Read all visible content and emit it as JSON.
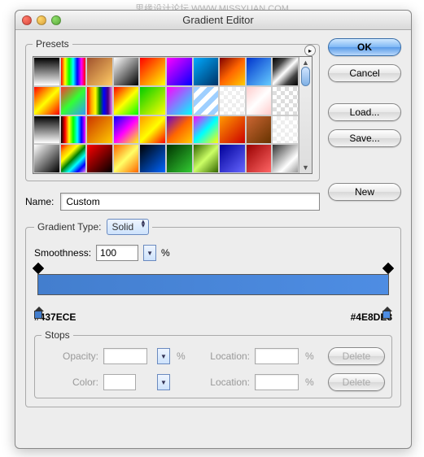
{
  "watermark": "思缘设计论坛  WWW.MISSYUAN.COM",
  "window": {
    "title": "Gradient Editor"
  },
  "buttons": {
    "ok": "OK",
    "cancel": "Cancel",
    "load": "Load...",
    "save": "Save...",
    "new": "New",
    "delete": "Delete"
  },
  "presets": {
    "legend": "Presets"
  },
  "name": {
    "label": "Name:",
    "value": "Custom"
  },
  "gradientType": {
    "label": "Gradient Type:",
    "value": "Solid"
  },
  "smoothness": {
    "label": "Smoothness:",
    "value": "100",
    "unit": "%"
  },
  "gradient": {
    "leftHex": "#437ECE",
    "rightHex": "#4E8DE3"
  },
  "stops": {
    "legend": "Stops",
    "opacityLabel": "Opacity:",
    "colorLabel": "Color:",
    "locationLabel": "Location:",
    "opacityValue": "",
    "opacityLocation": "",
    "colorLocation": "",
    "unit": "%"
  },
  "swatchGradients": [
    "linear-gradient(#000,#fff)",
    "linear-gradient(90deg,red,yellow,lime,cyan,blue,magenta,red)",
    "linear-gradient(135deg,#a0522d,#ffcc66)",
    "linear-gradient(135deg,#fff,#000)",
    "linear-gradient(135deg,#f00,#ff0)",
    "linear-gradient(135deg,#ff00ff,#00f)",
    "linear-gradient(135deg,#00aaff,#003366)",
    "linear-gradient(135deg,#800000,#ff6600,#ffcc00)",
    "linear-gradient(135deg,#0033cc,#66ccff)",
    "linear-gradient(135deg,#000,#444,#fff,#444,#000)",
    "linear-gradient(135deg,#ff0000,#ffff00,#ff0000)",
    "linear-gradient(135deg,#ff3333,#33ff33,#3399ff)",
    "linear-gradient(90deg,red,orange,yellow,green,blue,indigo,violet)",
    "linear-gradient(135deg,red,yellow,lime)",
    "linear-gradient(135deg,#00cc00,#ffff00)",
    "linear-gradient(135deg,#ff00ff,#00ffff)",
    "repeating-linear-gradient(135deg,#9ecfff 0 6px,#fff 6px 12px)",
    "repeating-conic-gradient(#eee 0 25%,#fff 0 50%)",
    "linear-gradient(135deg,#ffcccc,#fff,#ffcccc)",
    "repeating-conic-gradient(#ddd 0 25%,#fff 0 50%)",
    "linear-gradient(#000,#fff)",
    "linear-gradient(90deg,#000,red,yellow,lime,cyan,blue,magenta)",
    "linear-gradient(135deg,#cc3300,#ffcc00)",
    "linear-gradient(135deg,#0000ff,#ff00ff,#ffff00)",
    "linear-gradient(135deg,#ff9900,#ffff00,#ff0000)",
    "linear-gradient(135deg,#6600cc,#ff6600,#ffcc00)",
    "linear-gradient(135deg,#ff00ff,#00ffff,#ffff00)",
    "linear-gradient(135deg,#ff9900,#cc0000)",
    "linear-gradient(135deg,#cc6633,#663300)",
    "repeating-conic-gradient(#eee 0 25%,#fff 0 50%)",
    "linear-gradient(135deg,#fff,#000)",
    "linear-gradient(135deg,red,orange,yellow,green,cyan,blue,violet)",
    "linear-gradient(135deg,#ff0000,#000)",
    "linear-gradient(135deg,#ff6600,#ffff66,#ff6600)",
    "linear-gradient(135deg,#000,#0066ff)",
    "linear-gradient(135deg,#003300,#33cc33)",
    "linear-gradient(135deg,#336600,#ccff66,#336600)",
    "linear-gradient(135deg,#000099,#6666ff)",
    "linear-gradient(135deg,#990000,#ff6666)",
    "linear-gradient(135deg,#333,#999,#fff,#999)"
  ]
}
